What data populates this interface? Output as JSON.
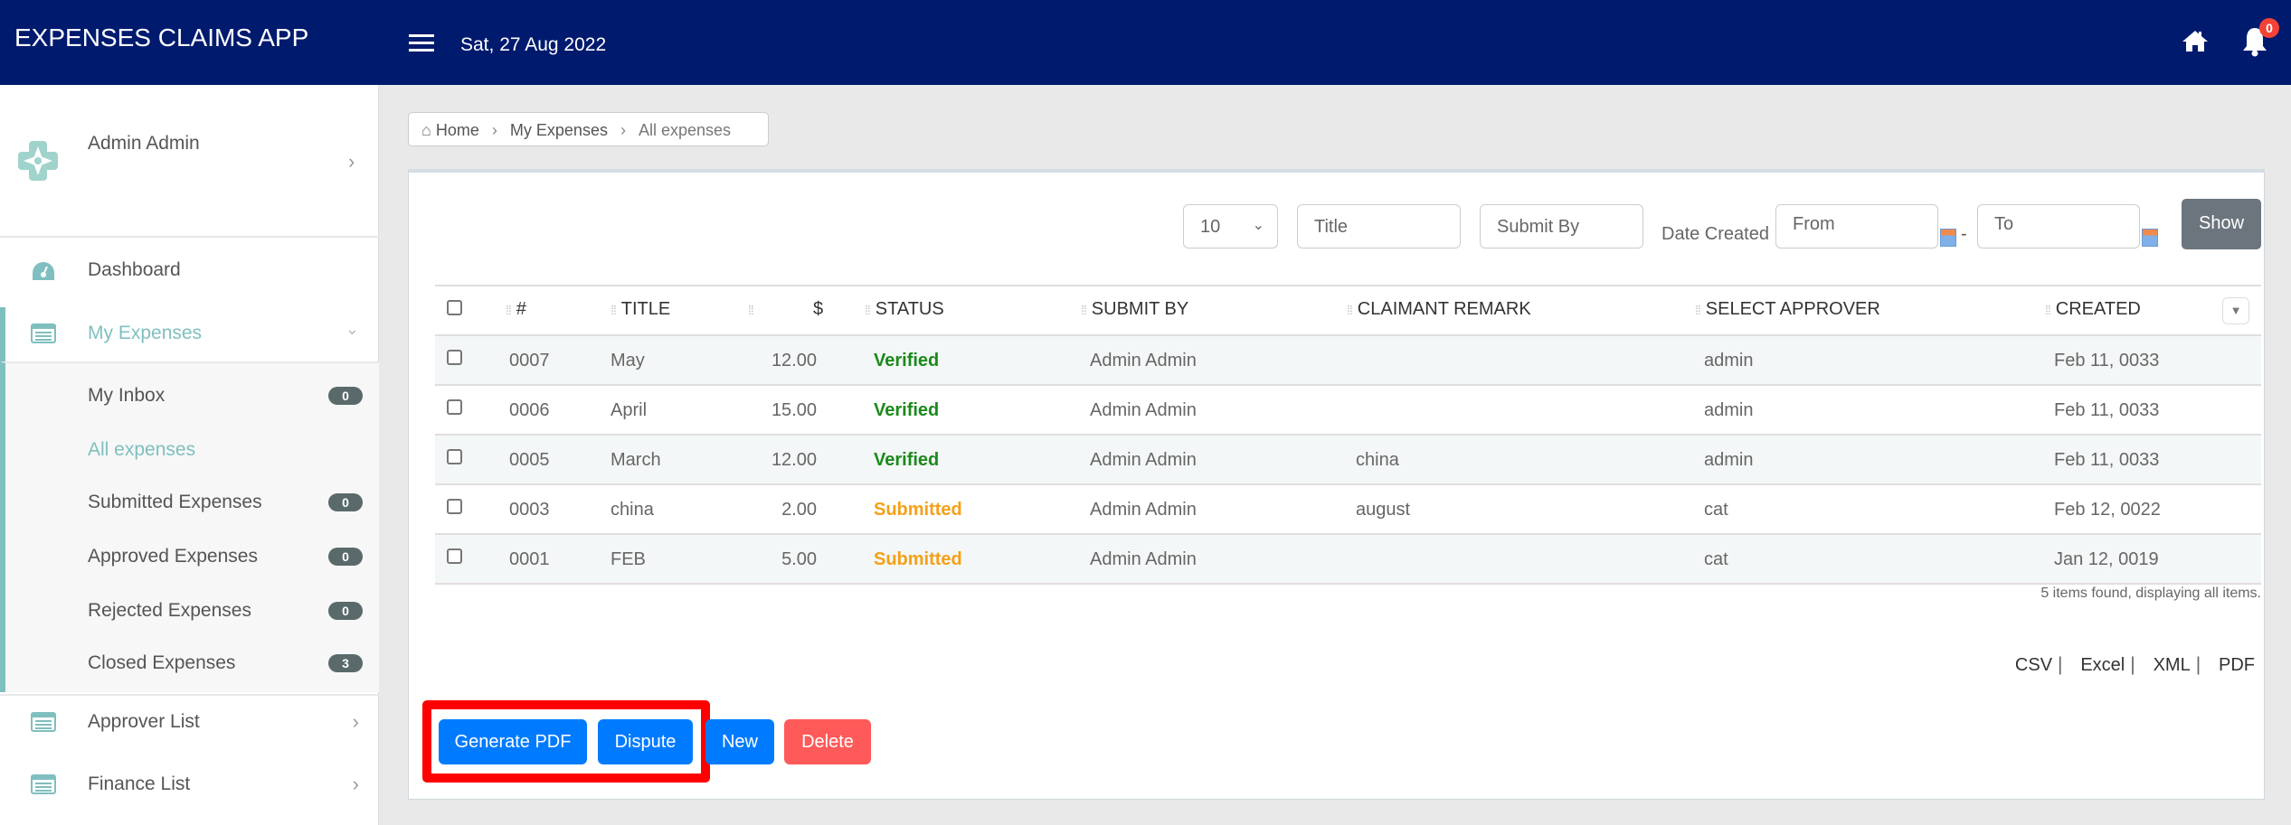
{
  "header": {
    "app_title": "EXPENSES CLAIMS APP",
    "date": "Sat, 27 Aug 2022",
    "notification_count": "0"
  },
  "sidebar": {
    "user_name": "Admin Admin",
    "items": [
      {
        "label": "Dashboard"
      },
      {
        "label": "My Expenses"
      },
      {
        "label": "Approver List"
      },
      {
        "label": "Finance List"
      }
    ],
    "submenu": [
      {
        "label": "My Inbox",
        "count": "0"
      },
      {
        "label": "All expenses"
      },
      {
        "label": "Submitted Expenses",
        "count": "0"
      },
      {
        "label": "Approved Expenses",
        "count": "0"
      },
      {
        "label": "Rejected Expenses",
        "count": "0"
      },
      {
        "label": "Closed Expenses",
        "count": "3"
      }
    ]
  },
  "breadcrumb": [
    "Home",
    "My Expenses",
    "All expenses"
  ],
  "filters": {
    "page_size": "10",
    "title_placeholder": "Title",
    "submit_by_placeholder": "Submit By",
    "date_created_label": "Date Created",
    "from_placeholder": "From",
    "to_placeholder": "To",
    "date_separator": "-",
    "show_label": "Show"
  },
  "table": {
    "headers": [
      "#",
      "TITLE",
      "$",
      "STATUS",
      "SUBMIT BY",
      "CLAIMANT REMARK",
      "SELECT APPROVER",
      "CREATED"
    ],
    "rows": [
      [
        "0007",
        "May",
        "12.00",
        "Verified",
        "Admin Admin",
        "",
        "admin",
        "Feb 11, 0033"
      ],
      [
        "0006",
        "April",
        "15.00",
        "Verified",
        "Admin Admin",
        "",
        "admin",
        "Feb 11, 0033"
      ],
      [
        "0005",
        "March",
        "12.00",
        "Verified",
        "Admin Admin",
        "china",
        "admin",
        "Feb 11, 0033"
      ],
      [
        "0003",
        "china",
        "2.00",
        "Submitted",
        "Admin Admin",
        "august",
        "cat",
        "Feb 12, 0022"
      ],
      [
        "0001",
        "FEB",
        "5.00",
        "Submitted",
        "Admin Admin",
        "",
        "cat",
        "Jan 12, 0019"
      ]
    ],
    "summary": "5 items found, displaying all items."
  },
  "export": [
    "CSV",
    "Excel",
    "XML",
    "PDF"
  ],
  "actions": {
    "generate_pdf": "Generate PDF",
    "dispute": "Dispute",
    "new": "New",
    "delete": "Delete"
  },
  "colors": {
    "header": "#001a6e",
    "primary": "#007bff",
    "danger": "#ff5a5a",
    "verified": "#1a8a1a",
    "submitted": "#f5a017",
    "highlight": "#ff0000"
  }
}
